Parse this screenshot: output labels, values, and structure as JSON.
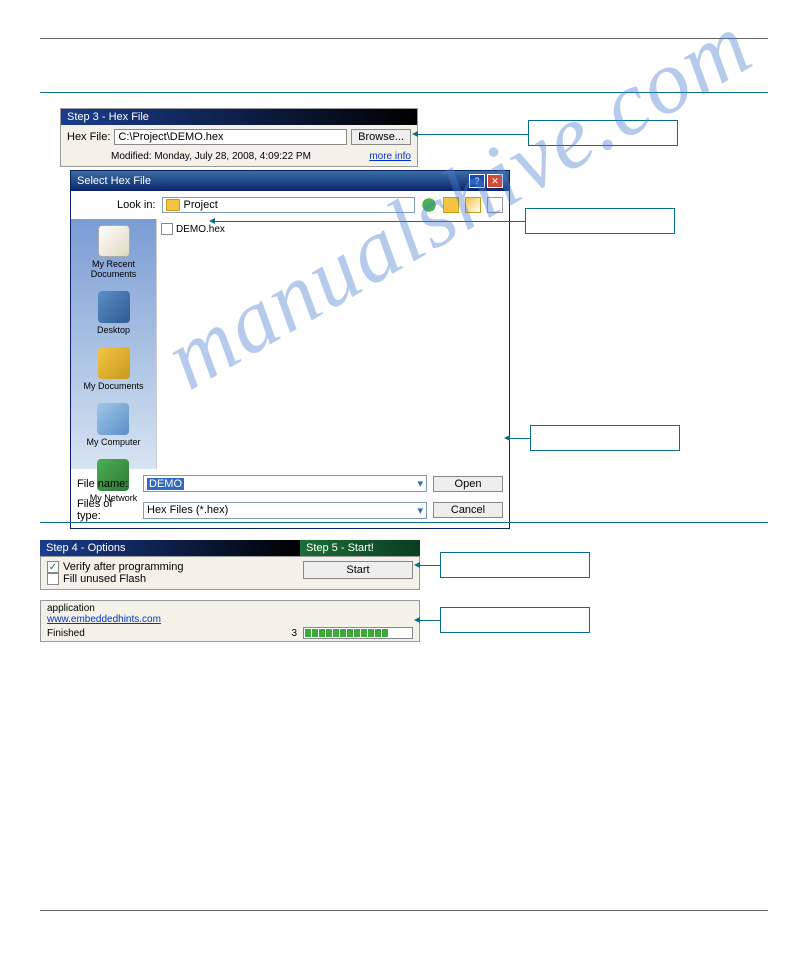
{
  "step3": {
    "title": "Step 3 - Hex File",
    "hexfile_label": "Hex File:",
    "hexfile_value": "C:\\Project\\DEMO.hex",
    "browse": "Browse...",
    "modified": "Modified: Monday, July 28, 2008, 4:09:22 PM",
    "moreinfo": "more info"
  },
  "dialog": {
    "title": "Select Hex File",
    "lookin_label": "Look in:",
    "lookin_value": "Project",
    "file": "DEMO.hex",
    "sidebar": {
      "recent": "My Recent Documents",
      "desktop": "Desktop",
      "mydocs": "My Documents",
      "mycomp": "My Computer",
      "mynet": "My Network"
    },
    "filename_label": "File name:",
    "filename_value": "DEMO",
    "filetype_label": "Files of type:",
    "filetype_value": "Hex Files (*.hex)",
    "open": "Open",
    "cancel": "Cancel"
  },
  "step4": {
    "title": "Step 4 - Options",
    "verify": "Verify after programming",
    "fill": "Fill unused Flash"
  },
  "step5": {
    "title": "Step 5 - Start!",
    "start": "Start"
  },
  "status": {
    "app_label": "application",
    "link": "www.embeddedhints.com",
    "finished": "Finished",
    "count": "3"
  },
  "watermark": "manualshive.com"
}
